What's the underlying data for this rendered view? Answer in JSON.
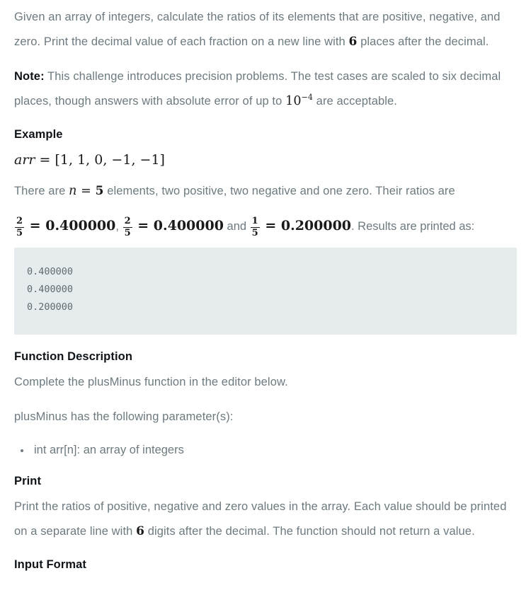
{
  "colors": {
    "body_text": "#6c7a80",
    "heading_text": "#0f1419",
    "math_text": "#1a1a1a",
    "code_background": "#e6ecee",
    "code_text": "#5f6b70",
    "page_background": "#ffffff"
  },
  "intro": {
    "part1": "Given an array of integers, calculate the ratios of its elements that are positive, negative, and zero. Print the decimal value of each fraction on a new line with ",
    "math_places": "6",
    "part2": " places after the decimal."
  },
  "note": {
    "label": "Note:",
    "part1": " This challenge introduces precision problems. The test cases are scaled to six decimal places, though answers with absolute error of up to ",
    "math_base": "10",
    "math_exponent": "−4",
    "part2": " are acceptable."
  },
  "example": {
    "heading": "Example",
    "arr_variable": "arr",
    "arr_equals": "=",
    "arr_value": "[1, 1, 0, −1, −1]",
    "sentence_part1": "There are ",
    "n_variable": "n",
    "n_equals": "=",
    "n_value": "5",
    "sentence_part2": " elements, two positive, two negative and one zero. Their ratios are",
    "ratios": [
      {
        "numerator": "2",
        "denominator": "5",
        "equals": "=",
        "value": "0.400000",
        "separator": ","
      },
      {
        "numerator": "2",
        "denominator": "5",
        "equals": "=",
        "value": "0.400000",
        "separator": " and "
      },
      {
        "numerator": "1",
        "denominator": "5",
        "equals": "=",
        "value": "0.200000",
        "separator": ""
      }
    ],
    "results_text": ". Results are printed as:",
    "code_output": "0.400000\n0.400000\n0.200000"
  },
  "function_description": {
    "heading": "Function Description",
    "complete_text": "Complete the plusMinus function in the editor below.",
    "parameters_intro": "plusMinus has the following parameter(s):",
    "parameters": [
      "int arr[n]: an array of integers"
    ]
  },
  "print_section": {
    "heading": "Print",
    "part1": "Print the ratios of positive, negative and zero values in the array. Each value should be printed on a separate line with ",
    "math_digits": "6",
    "part2": " digits after the decimal. The function should not return a value."
  },
  "input_format": {
    "heading": "Input Format"
  }
}
